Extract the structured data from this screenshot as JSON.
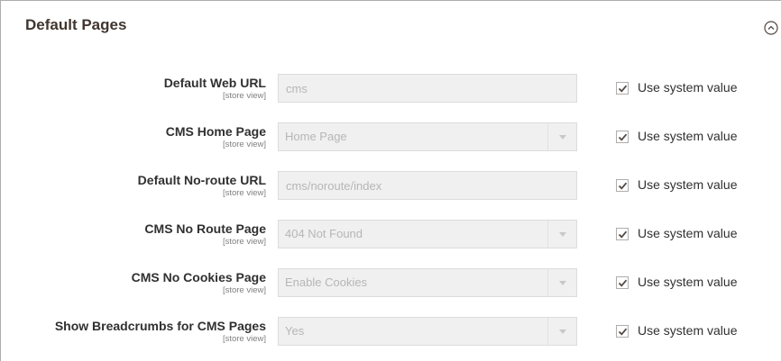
{
  "section": {
    "title": "Default Pages",
    "collapse_icon": "chevron-up-circle-icon"
  },
  "fields": [
    {
      "label": "Default Web URL",
      "scope": "[store view]",
      "type": "input",
      "value": "cms",
      "checkbox_label": "Use system value",
      "checked": true
    },
    {
      "label": "CMS Home Page",
      "scope": "[store view]",
      "type": "select",
      "value": "Home Page",
      "checkbox_label": "Use system value",
      "checked": true
    },
    {
      "label": "Default No-route URL",
      "scope": "[store view]",
      "type": "input",
      "value": "cms/noroute/index",
      "checkbox_label": "Use system value",
      "checked": true
    },
    {
      "label": "CMS No Route Page",
      "scope": "[store view]",
      "type": "select",
      "value": "404 Not Found",
      "checkbox_label": "Use system value",
      "checked": true
    },
    {
      "label": "CMS No Cookies Page",
      "scope": "[store view]",
      "type": "select",
      "value": "Enable Cookies",
      "checkbox_label": "Use system value",
      "checked": true
    },
    {
      "label": "Show Breadcrumbs for CMS Pages",
      "scope": "[store view]",
      "type": "select",
      "value": "Yes",
      "checkbox_label": "Use system value",
      "checked": true
    }
  ],
  "colors": {
    "title": "#41362f",
    "label": "#303030",
    "disabled_bg": "#f0f0f0",
    "disabled_text": "#b6b6b6"
  }
}
